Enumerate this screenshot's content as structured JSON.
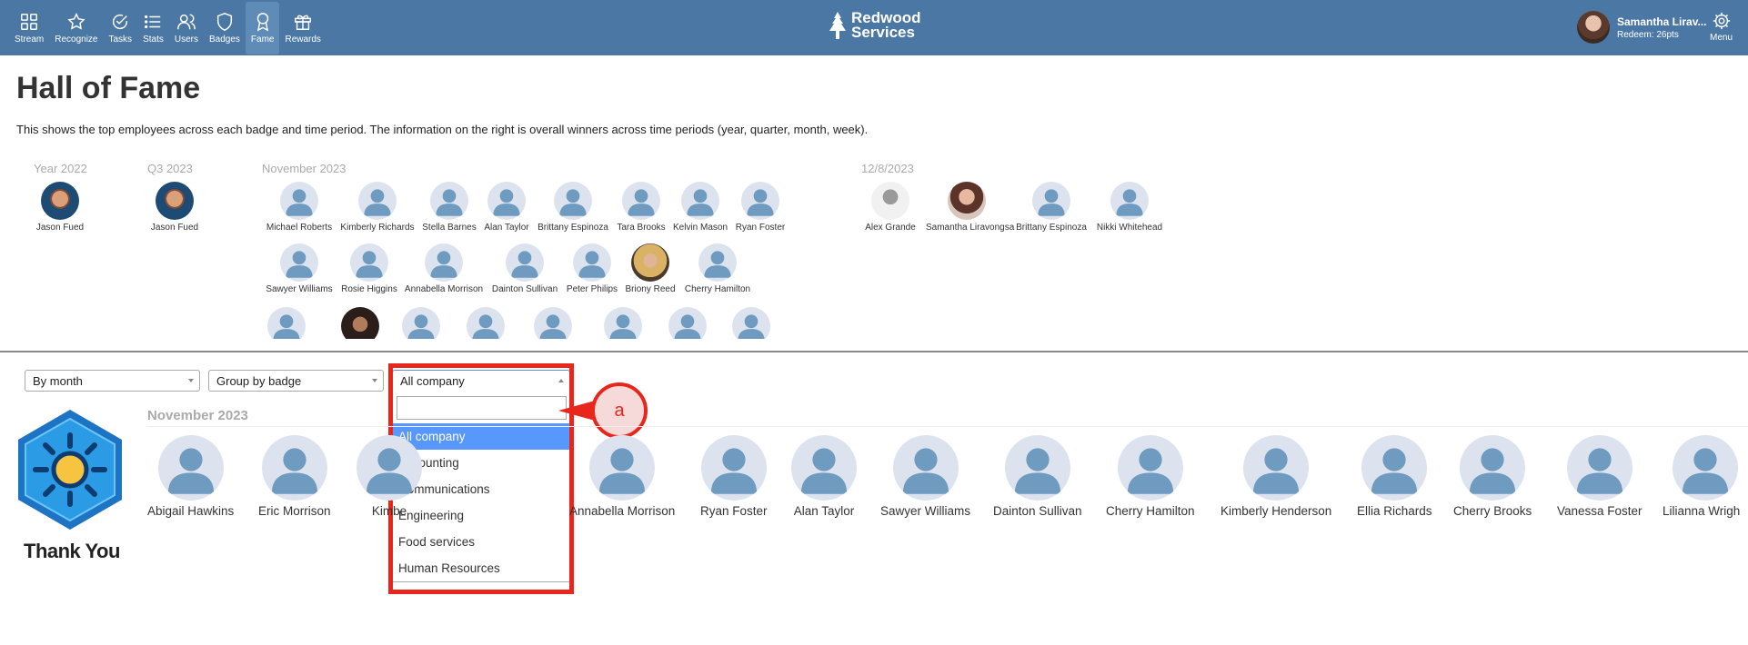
{
  "nav": {
    "items": [
      {
        "label": "Stream",
        "icon": "grid-icon"
      },
      {
        "label": "Recognize",
        "icon": "star-icon"
      },
      {
        "label": "Tasks",
        "icon": "check-circle-icon"
      },
      {
        "label": "Stats",
        "icon": "list-icon"
      },
      {
        "label": "Users",
        "icon": "users-icon"
      },
      {
        "label": "Badges",
        "icon": "shield-icon"
      },
      {
        "label": "Fame",
        "icon": "award-icon",
        "active": true
      },
      {
        "label": "Rewards",
        "icon": "gift-icon"
      }
    ],
    "color": "#4a77a3"
  },
  "logo": {
    "line1": "Redwood",
    "line2": "Services"
  },
  "user": {
    "name": "Samantha Lirav...",
    "points": "Redeem: 26pts"
  },
  "menu_label": "Menu",
  "page": {
    "title": "Hall of Fame",
    "description": "This shows the top employees across each badge and time period. The information on the right is overall winners across time periods (year, quarter, month, week)."
  },
  "overall": {
    "periods": {
      "year": "Year 2022",
      "quarter": "Q3 2023",
      "month": "November 2023",
      "week": "12/8/2023"
    },
    "year_winners": [
      "Jason Fued"
    ],
    "quarter_winners": [
      "Jason Fued"
    ],
    "month_winners_row1": [
      "Michael Roberts",
      "Kimberly Richards",
      "Stella Barnes",
      "Alan Taylor",
      "Brittany Espinoza",
      "Tara Brooks",
      "Kelvin Mason",
      "Ryan Foster"
    ],
    "month_winners_row2": [
      "Sawyer Williams",
      "Rosie Higgins",
      "Annabella Morrison",
      "Dainton Sullivan",
      "Peter Philips",
      "Briony Reed",
      "Cherry Hamilton"
    ],
    "week_winners": [
      "Alex Grande",
      "Samantha Liravongsa",
      "Brittany Espinoza",
      "Nikki Whitehead"
    ]
  },
  "filters": {
    "period": "By month",
    "grouping": "Group by badge",
    "company": "All company",
    "search_value": "",
    "options": [
      "All company",
      "Accounting",
      "Communications",
      "Engineering",
      "Food services",
      "Human Resources"
    ],
    "selected_index": 0
  },
  "annotation": {
    "label": "a",
    "color": "#e8261b"
  },
  "badge_section": {
    "badge_name": "Thank You",
    "period": "November 2023",
    "winners": [
      "Abigail Hawkins",
      "Eric Morrison",
      "Kimbe",
      "Annabella Morrison",
      "Ryan Foster",
      "Alan Taylor",
      "Sawyer Williams",
      "Dainton Sullivan",
      "Cherry Hamilton",
      "Kimberly Henderson",
      "Ellia Richards",
      "Cherry Brooks",
      "Vanessa Foster",
      "Lilianna Wrigh"
    ]
  }
}
